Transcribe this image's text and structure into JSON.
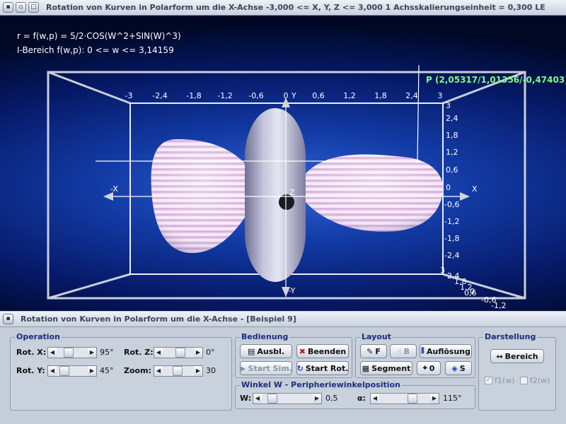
{
  "main_window": {
    "title": "Rotation von Kurven in Polarform um die X-Achse   -3,000 <= X, Y, Z <= 3,000    1 Achsskalierungseinheit = 0,300 LE",
    "formula": "r = f(w,p) = 5/2·COS(W^2+SIN(W)^3)",
    "interval": "I-Bereich f(w,p): 0 <= w <= 3,14159",
    "point_label": "P (2,05317/1,01356/-0,47403)",
    "axes": {
      "top_ticks": [
        "-3",
        "-2,4",
        "-1,8",
        "-1,2",
        "-0,6",
        "0",
        "0,6",
        "1,2",
        "1,8",
        "2,4",
        "3"
      ],
      "right_ticks": [
        "3",
        "2,4",
        "1,8",
        "1,2",
        "0,6",
        "0",
        "-0,6",
        "-1,2",
        "-1,8",
        "-2,4"
      ],
      "diag_ticks": [
        "3",
        "2,4",
        "1,8",
        "1,2",
        "0,6",
        "0",
        "-0,6",
        "-1,2"
      ],
      "x_pos": "X",
      "x_neg": "-X",
      "y_pos": "Y",
      "y_neg": "-Y",
      "z_label": "Z"
    }
  },
  "control_window": {
    "title": "Rotation von Kurven in Polarform um die X-Achse - [Beispiel 9]"
  },
  "operation": {
    "label": "Operation",
    "rot_x_label": "Rot. X:",
    "rot_x_value": "95°",
    "rot_y_label": "Rot. Y:",
    "rot_y_value": "45°",
    "rot_z_label": "Rot. Z:",
    "rot_z_value": "0°",
    "zoom_label": "Zoom:",
    "zoom_value": "30"
  },
  "bedienung": {
    "label": "Bedienung",
    "ausbl": "Ausbl.",
    "beenden": "Beenden",
    "start_sim": "Start Sim.",
    "start_rot": "Start Rot."
  },
  "layout": {
    "label": "Layout",
    "f_btn": "F",
    "b_btn": "B",
    "aufloesung": "Auflösung",
    "segment": "Segment",
    "zero_btn": "0",
    "s_btn": "S"
  },
  "darstellung": {
    "label": "Darstellung",
    "bereich": "Bereich",
    "f1": "f1(w)",
    "f2": "f2(w)"
  },
  "winkel": {
    "label": "Winkel W - Peripheriewinkelposition",
    "w_label": "W:",
    "w_value": "0,5",
    "alpha_label": "α:",
    "alpha_value": "115°"
  },
  "icons": [
    "window-control-icon",
    "save-icon",
    "close-x-icon",
    "play-icon",
    "rotate-icon",
    "resolution-icon",
    "grid-icon",
    "crosshair-icon",
    "paint-icon",
    "range-arrow-icon"
  ],
  "colors": {
    "label_blue": "#1a2d80",
    "point_green": "#7dff7d",
    "shape_pink": "#e3bde4",
    "shape_silver": "#c6c6de"
  }
}
